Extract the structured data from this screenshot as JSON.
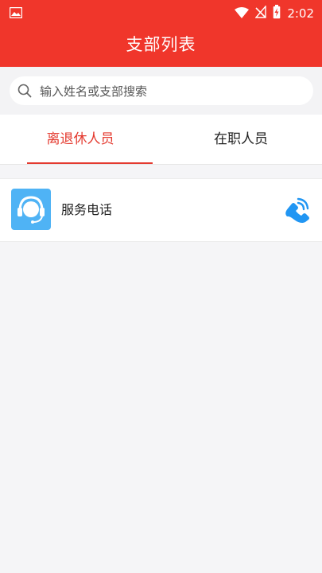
{
  "status_bar": {
    "time": "2:02",
    "icons": [
      "image-notification-icon",
      "wifi-icon",
      "no-signal-icon",
      "battery-charging-icon"
    ]
  },
  "header": {
    "title": "支部列表"
  },
  "search": {
    "placeholder": "输入姓名或支部搜索"
  },
  "tabs": [
    {
      "label": "离退休人员",
      "active": true
    },
    {
      "label": "在职人员",
      "active": false
    }
  ],
  "list": {
    "items": [
      {
        "label": "服务电话",
        "avatar_icon": "customer-service-headset-icon",
        "action_icon": "phone-call-icon"
      }
    ]
  },
  "colors": {
    "primary": "#f0362b",
    "tab_active": "#e43a2f",
    "avatar_bg": "#4fb3f5",
    "call_icon": "#2196f3"
  }
}
